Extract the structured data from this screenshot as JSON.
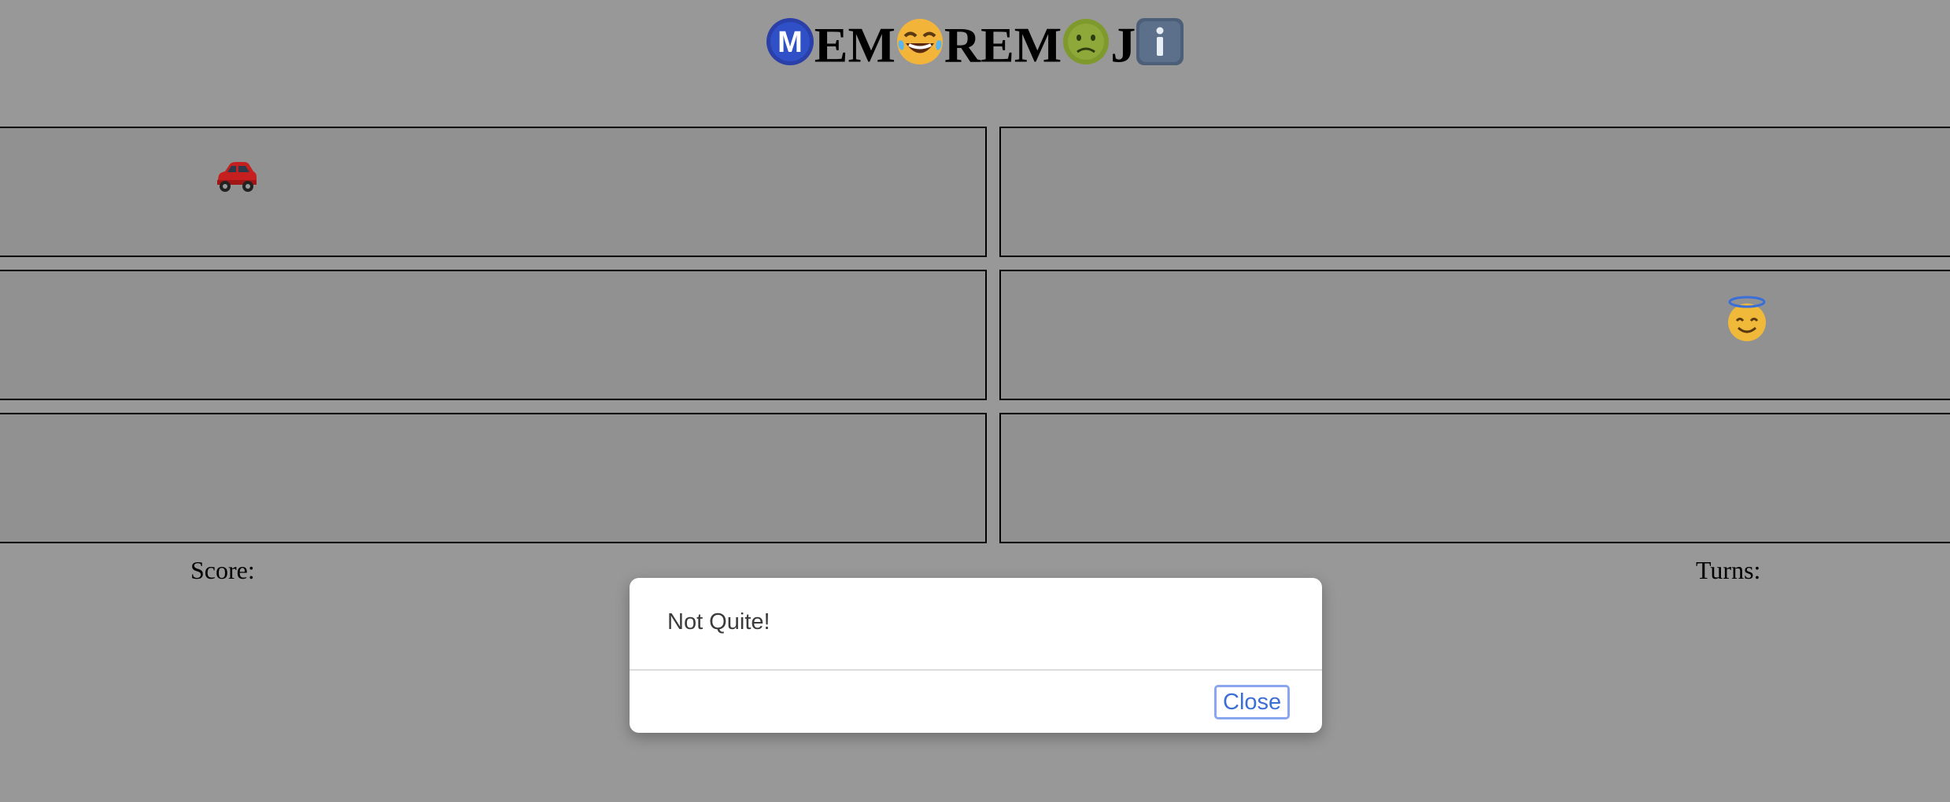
{
  "header": {
    "title_letters": [
      "EM",
      "REM",
      "J"
    ],
    "icons": [
      "m-circle-icon",
      "laughing-emoji-icon",
      "nauseated-emoji-icon",
      "info-icon"
    ]
  },
  "board": {
    "cards": [
      {
        "emoji": "car-emoji-icon",
        "revealed": true
      },
      {
        "emoji": "",
        "revealed": false
      },
      {
        "emoji": "",
        "revealed": false
      },
      {
        "emoji": "halo-smile-emoji-icon",
        "revealed": true
      },
      {
        "emoji": "",
        "revealed": false
      },
      {
        "emoji": "",
        "revealed": false
      }
    ]
  },
  "stats": {
    "score_label": "Score:",
    "turns_label": "Turns:"
  },
  "dialog": {
    "message": "Not Quite!",
    "close_label": "Close"
  },
  "colors": {
    "background": "#989898",
    "card": "#919191",
    "close_text": "#3b6fd6",
    "close_focus_ring": "#8aa6ee"
  }
}
